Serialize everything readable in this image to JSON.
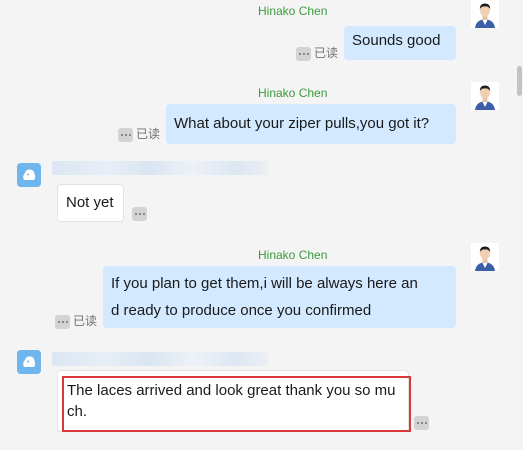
{
  "messages": [
    {
      "sender": "Hinako Chen",
      "text": "Sounds good",
      "read_status": "已读"
    },
    {
      "sender": "Hinako Chen",
      "text": "What about your ziper pulls,you got it?",
      "read_status": "已读"
    },
    {
      "text": "Not yet"
    },
    {
      "sender": "Hinako Chen",
      "line1": "If you plan to get them,i will be always here an",
      "line2": "d ready to produce once you confirmed",
      "read_status": "已读"
    },
    {
      "line1": "The laces arrived and look great thank you so mu",
      "line2": "ch."
    }
  ],
  "colors": {
    "outgoing_bubble": "#d2e9ff",
    "sender_name": "#3c9a3c",
    "highlight": "#d83a3a",
    "avatar_blue": "#6fb6ee"
  }
}
